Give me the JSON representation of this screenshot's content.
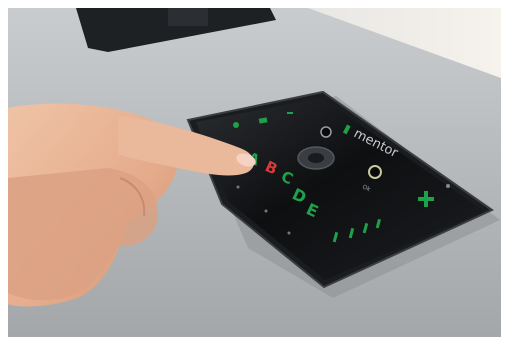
{
  "photo": {
    "brand_label": "mentor",
    "ok_label": "Ok",
    "letters": [
      "A",
      "B",
      "C",
      "D",
      "E"
    ],
    "highlighted_letter": "B",
    "colors": {
      "table": "#b9bcbe",
      "device_body": "#1a1c1f",
      "device_glass": "#0c0d0f",
      "key_green": "#1fa04a",
      "key_red": "#d63a3a",
      "skin": "#e8b596",
      "monitor": "#1e2124",
      "floor_light": "#f3efe8"
    }
  }
}
